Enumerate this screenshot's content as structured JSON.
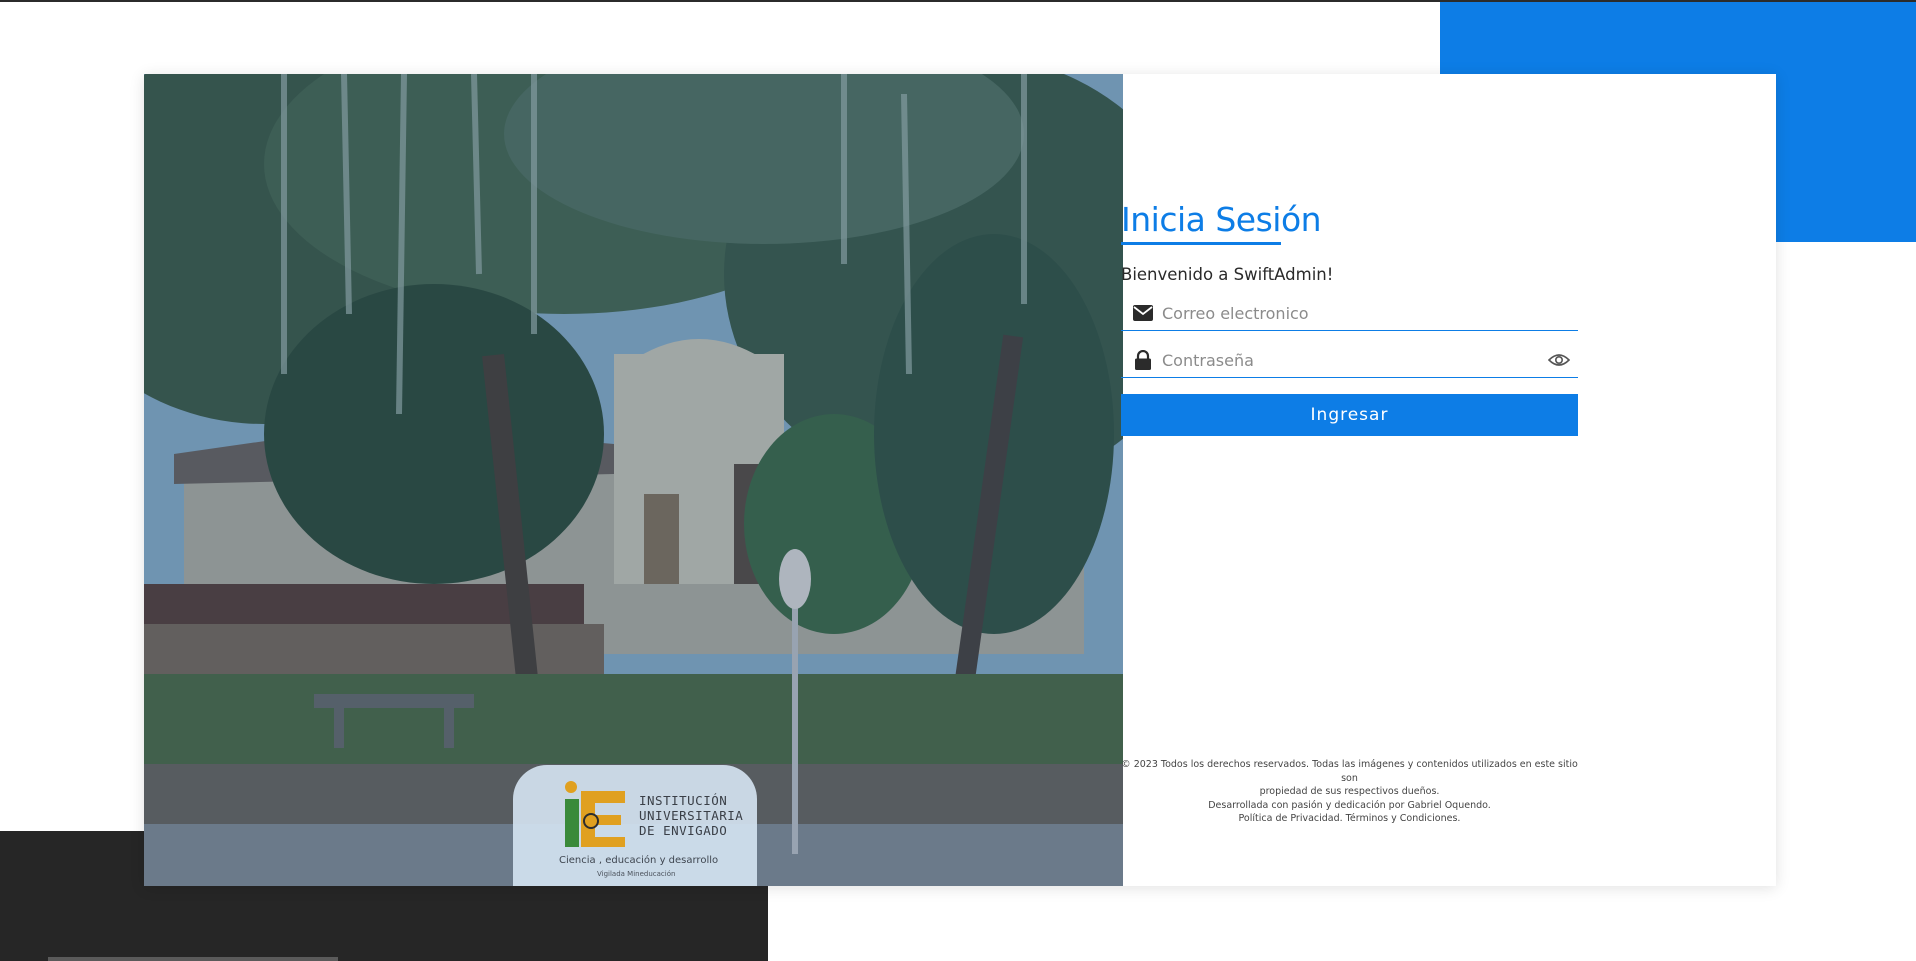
{
  "colors": {
    "accent": "#0d7de6",
    "dark_block": "#262626",
    "text": "#2a2a2a"
  },
  "hero_image": {
    "logo": {
      "name_line_1": "Institución",
      "name_line_2": "Universitaria",
      "name_line_3": "de Envigado",
      "tagline": "Ciencia , educación y desarrollo",
      "sub": "Vigilada Mineducación"
    }
  },
  "login": {
    "title": "Inicia Sesión",
    "welcome": "Bienvenido a SwiftAdmin!",
    "email": {
      "placeholder": "Correo electronico",
      "value": "",
      "icon": "envelope-icon"
    },
    "password": {
      "placeholder": "Contraseña",
      "value": "",
      "icon": "lock-icon",
      "toggle_icon": "eye-icon"
    },
    "submit_label": "Ingresar"
  },
  "footer": {
    "line_1": "© 2023 Todos los derechos reservados. Todas las imágenes y contenidos utilizados en este sitio son",
    "line_2": "propiedad de sus respectivos dueños.",
    "line_3": "Desarrollada con pasión y dedicación por Gabriel Oquendo.",
    "line_4": "Política de Privacidad. Términos y Condiciones."
  }
}
